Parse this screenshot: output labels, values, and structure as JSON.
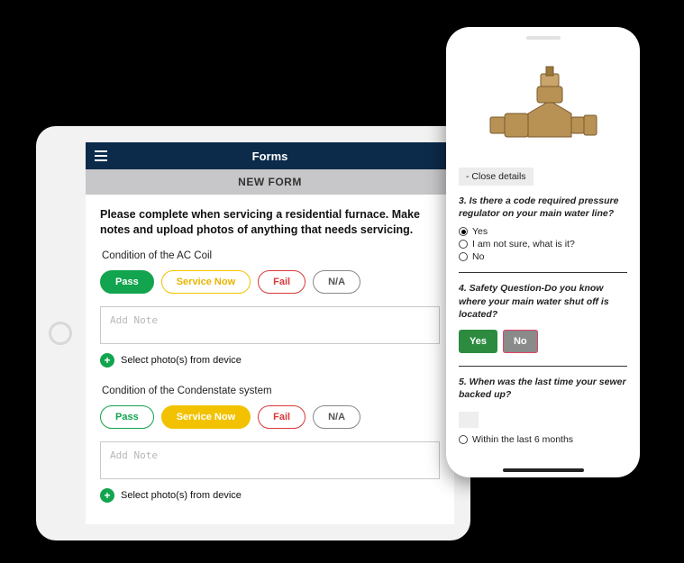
{
  "tablet": {
    "header_title": "Forms",
    "subheader": "NEW FORM",
    "instructions": "Please complete when servicing a residential furnace. Make notes and upload photos of anything that needs servicing.",
    "sections": [
      {
        "label": "Condition of the AC Coil",
        "pass": "Pass",
        "service": "Service Now",
        "fail": "Fail",
        "na": "N/A",
        "selected": "pass",
        "note_placeholder": "Add Note",
        "photo_label": "Select photo(s) from device"
      },
      {
        "label": "Condition of the Condenstate system",
        "pass": "Pass",
        "service": "Service Now",
        "fail": "Fail",
        "na": "N/A",
        "selected": "service",
        "note_placeholder": "Add Note",
        "photo_label": "Select photo(s) from device"
      }
    ]
  },
  "phone": {
    "close_details": "- Close details",
    "q3": {
      "text": "3. Is there a code required pressure regulator on your main water line?",
      "opt_yes": "Yes",
      "opt_unsure": "I am not sure, what is it?",
      "opt_no": "No",
      "selected": "yes"
    },
    "q4": {
      "text": "4. Safety Question-Do you know where your main water shut off is located?",
      "yes": "Yes",
      "no": "No"
    },
    "q5": {
      "text": "5. When was the last time your sewer backed up?",
      "opt_within": "Within the last 6 months"
    }
  }
}
